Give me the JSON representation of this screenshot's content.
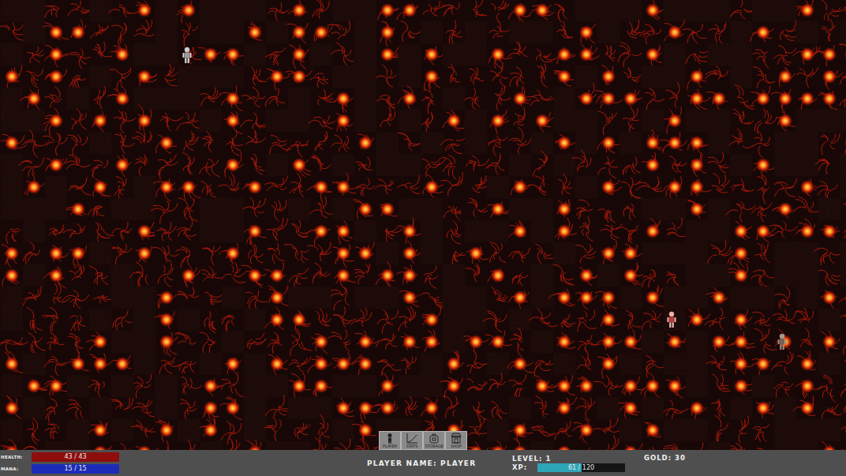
{
  "map": {
    "entities": [
      {
        "kind": "skeleton"
      },
      {
        "kind": "player"
      },
      {
        "kind": "ghoul"
      }
    ]
  },
  "toolbar": [
    {
      "label": "PLAYER"
    },
    {
      "label": "STATS"
    },
    {
      "label": "STORAGE"
    },
    {
      "label": "SHOP"
    }
  ],
  "status_bar": {
    "health": {
      "label": "HEALTH:",
      "reading": "43 / 43",
      "level": 1
    },
    "mana": {
      "label": "MANA:",
      "reading": "15 / 15",
      "level": 1
    },
    "player_name": "PLAYER NAME: PLAYER",
    "level": "LEVEL: 1",
    "xp": {
      "label": "XP:",
      "reading": "61 / 120",
      "level": 0.508
    },
    "gold": "GOLD: 30"
  }
}
